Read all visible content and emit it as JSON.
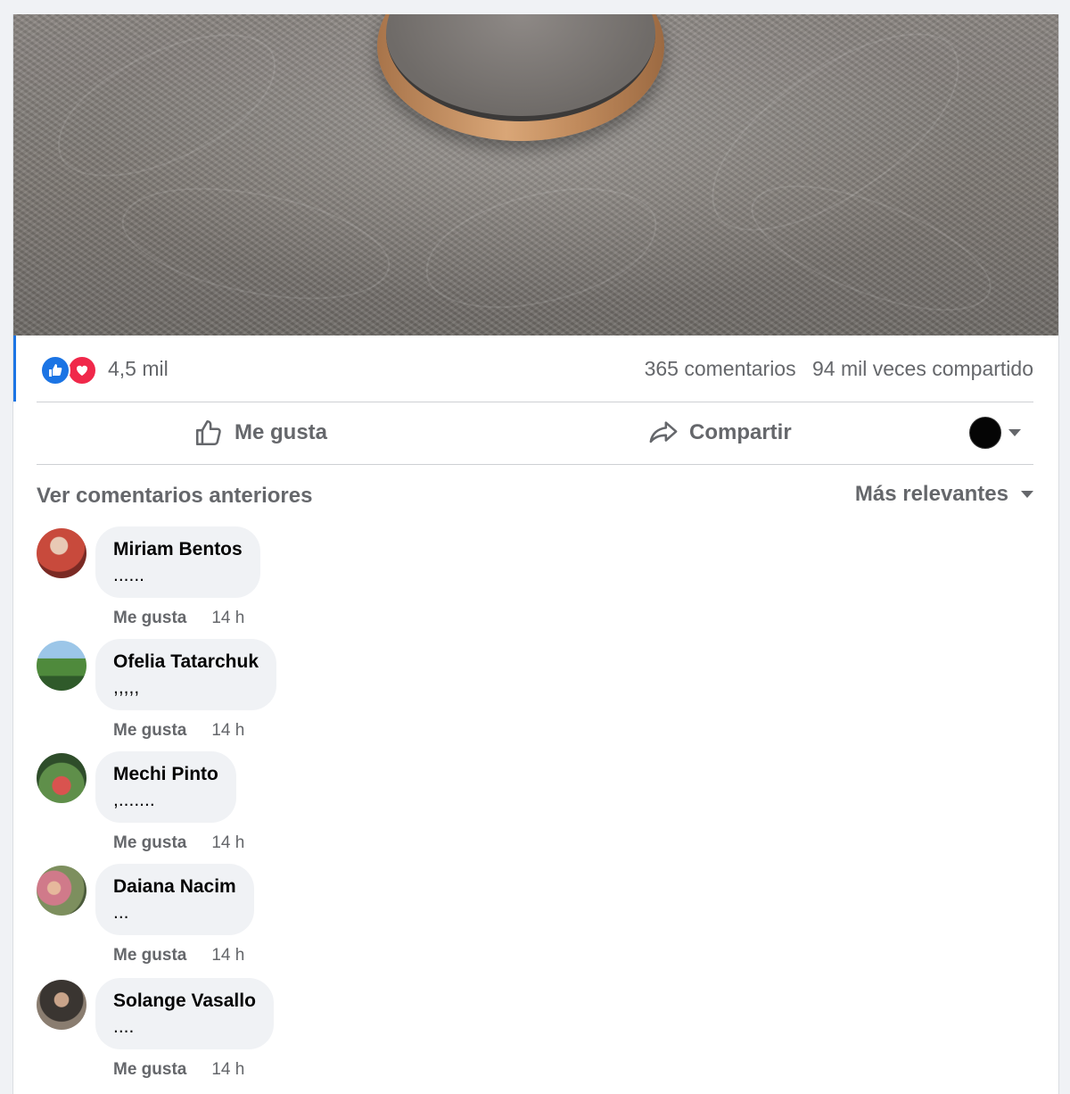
{
  "post": {
    "reactions": {
      "icons": [
        "like-icon",
        "love-icon"
      ],
      "count": "4,5 mil"
    },
    "comments_count": "365 comentarios",
    "shares_count": "94 mil veces compartido"
  },
  "actions": {
    "like_label": "Me gusta",
    "share_label": "Compartir"
  },
  "comments_section": {
    "view_previous": "Ver comentarios anteriores",
    "sort_label": "Más relevantes",
    "items": [
      {
        "author": "Miriam Bentos",
        "text": "......",
        "like_label": "Me gusta",
        "time": "14 h"
      },
      {
        "author": "Ofelia Tatarchuk",
        "text": ",,,,,",
        "like_label": "Me gusta",
        "time": "14 h"
      },
      {
        "author": "Mechi Pinto",
        "text": ",.......",
        "like_label": "Me gusta",
        "time": "14 h"
      },
      {
        "author": "Daiana Nacim",
        "text": "...",
        "like_label": "Me gusta",
        "time": "14 h"
      },
      {
        "author": "Solange Vasallo",
        "text": "....",
        "like_label": "Me gusta",
        "time": "14 h"
      }
    ]
  },
  "colors": {
    "accent": "#1b74e4",
    "love": "#f0284a",
    "secondary_text": "#65676b",
    "bubble": "#f0f2f5"
  }
}
